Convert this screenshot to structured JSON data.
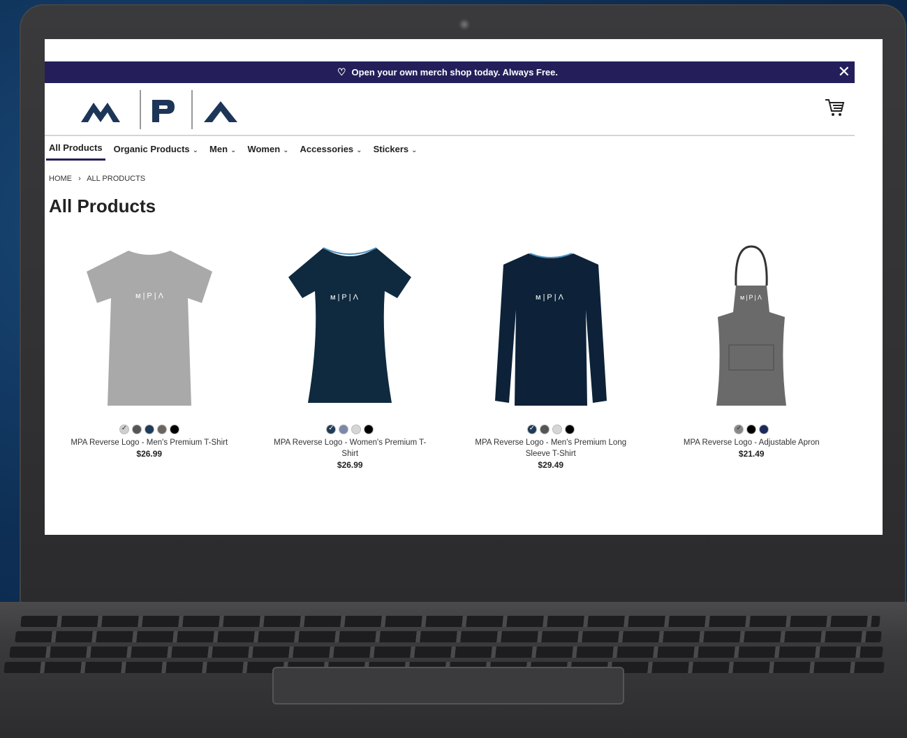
{
  "promo": {
    "text": "Open your own merch shop today. Always Free.",
    "icon": "diamond-icon",
    "close": "✕"
  },
  "brand": {
    "logo_text": "MPA",
    "color": "#1d3557"
  },
  "nav": {
    "items": [
      {
        "label": "All Products",
        "active": true
      },
      {
        "label": "Organic Products"
      },
      {
        "label": "Men"
      },
      {
        "label": "Women"
      },
      {
        "label": "Accessories"
      },
      {
        "label": "Stickers"
      }
    ]
  },
  "breadcrumb": {
    "home": "HOME",
    "sep": "›",
    "current": "ALL PRODUCTS"
  },
  "page_title": "All Products",
  "products": [
    {
      "name": "MPA Reverse Logo - Men's Premium T-Shirt",
      "price": "$26.99",
      "type": "tshirt",
      "color": "#a9a9a9",
      "swatches": [
        "#cfcfcf",
        "#555555",
        "#1f3b57",
        "#6b6560",
        "#000000"
      ],
      "selected": 0
    },
    {
      "name": "MPA Reverse Logo - Women's Premium T-Shirt",
      "price": "$26.99",
      "type": "womens",
      "color": "#0f2a3f",
      "swatches": [
        "#1f3b57",
        "#7d88a8",
        "#d6d6d6",
        "#000000"
      ],
      "selected": 0
    },
    {
      "name": "MPA Reverse Logo - Men's Premium Long Sleeve T-Shirt",
      "price": "$29.49",
      "type": "longsleeve",
      "color": "#0d2238",
      "swatches": [
        "#1f3b57",
        "#555555",
        "#d6d6d6",
        "#000000"
      ],
      "selected": 0
    },
    {
      "name": "MPA Reverse Logo - Adjustable Apron",
      "price": "$21.49",
      "type": "apron",
      "color": "#6a6a6a",
      "swatches": [
        "#888888",
        "#000000",
        "#1a2a5a"
      ],
      "selected": 0
    }
  ]
}
